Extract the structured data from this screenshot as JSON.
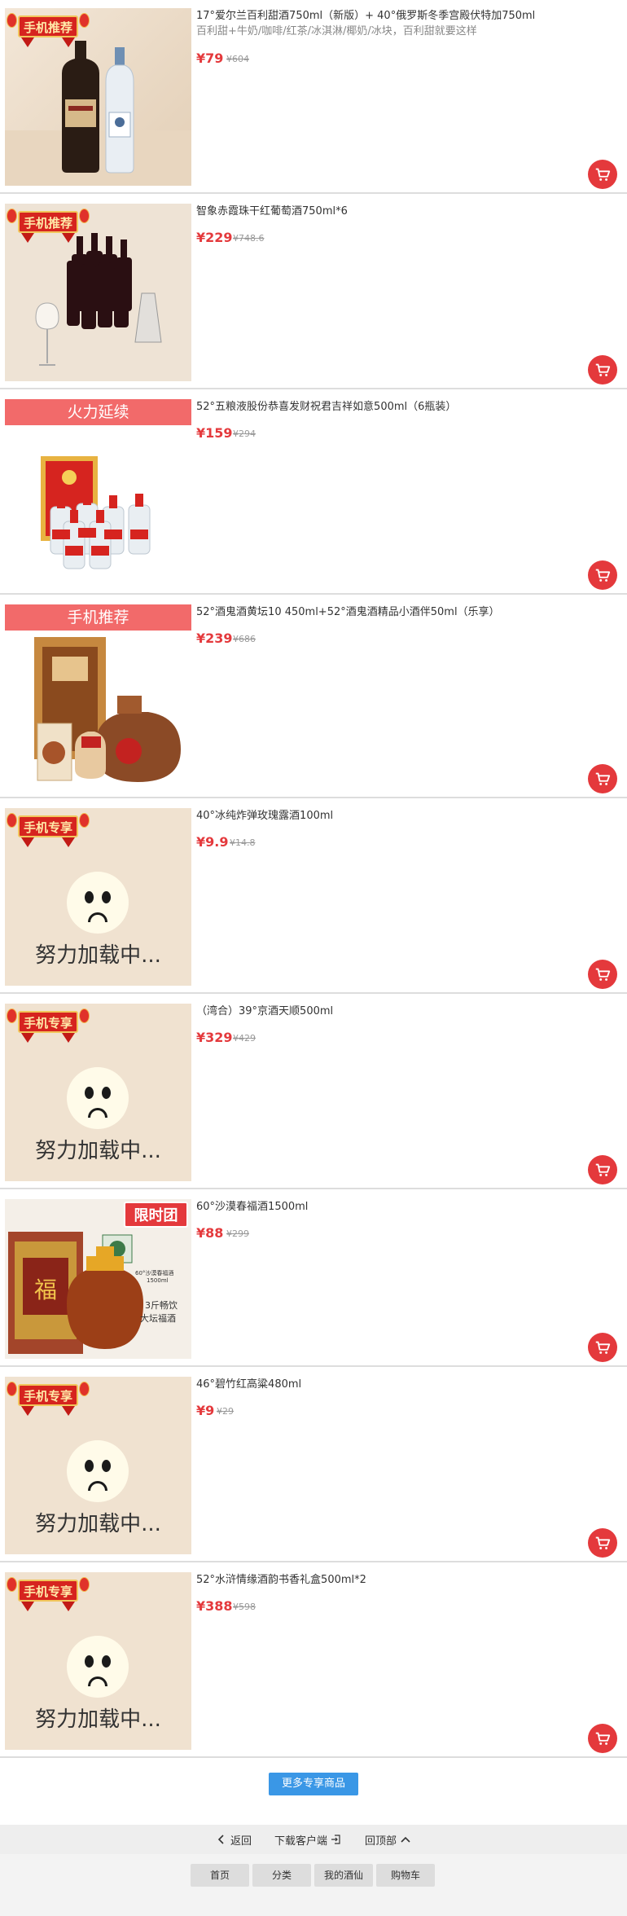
{
  "products": [
    {
      "title": "17°爱尔兰百利甜酒750ml（新版）+ 40°俄罗斯冬季宫殿伏特加750ml",
      "subtitle": "百利甜+牛奶/咖啡/红茶/冰淇淋/椰奶/冰块，百利甜就要这样",
      "price": "¥79",
      "original_price": "¥604",
      "badge": "手机推荐",
      "badge_style": "ribbon",
      "image": "bottles",
      "cart_icon": "cart-icon"
    },
    {
      "title": "智象赤霞珠干红葡萄酒750ml*6",
      "subtitle": "",
      "price": "¥229",
      "original_price": "¥748.6",
      "badge": "手机推荐",
      "badge_style": "ribbon",
      "image": "wine-set"
    },
    {
      "title": "52°五粮液股份恭喜发财祝君吉祥如意500ml（6瓶装）",
      "subtitle": "",
      "price": "¥159",
      "original_price": "¥294",
      "badge": "火力延续",
      "badge_style": "flat",
      "image": "liquor-box"
    },
    {
      "title": "52°酒鬼酒黄坛10 450ml+52°酒鬼酒精品小酒伴50ml（乐享）",
      "subtitle": "",
      "price": "¥239",
      "original_price": "¥686",
      "badge": "手机推荐",
      "badge_style": "flat",
      "image": "jiugui"
    },
    {
      "title": "40°冰纯炸弹玫瑰露酒100ml",
      "subtitle": "",
      "price": "¥9.9",
      "original_price": "¥14.8",
      "badge": "手机专享",
      "badge_style": "ribbon",
      "image": "loading",
      "loading_text": "努力加载中..."
    },
    {
      "title": "（湾合）39°京酒天顺500ml",
      "subtitle": "",
      "price": "¥329",
      "original_price": "¥429",
      "badge": "手机专享",
      "badge_style": "ribbon",
      "image": "loading",
      "loading_text": "努力加载中..."
    },
    {
      "title": "60°沙漠春福酒1500ml",
      "subtitle": "",
      "price": "¥88",
      "original_price": "¥299",
      "badge": "限时团",
      "badge_style": "tag",
      "image": "fu-jar",
      "image_texts": [
        "福",
        "60°沙漠春福酒",
        "1500ml",
        "3斤畅饮",
        "大坛福酒"
      ]
    },
    {
      "title": "46°碧竹红高粱480ml",
      "subtitle": "",
      "price": "¥9",
      "original_price": "¥29",
      "badge": "手机专享",
      "badge_style": "ribbon",
      "image": "loading",
      "loading_text": "努力加载中..."
    },
    {
      "title": "52°水浒情缘酒韵书香礼盒500ml*2",
      "subtitle": "",
      "price": "¥388",
      "original_price": "¥598",
      "badge": "手机专享",
      "badge_style": "ribbon",
      "image": "loading",
      "loading_text": "努力加载中..."
    }
  ],
  "more_button": "更多专享商品",
  "footer_nav": {
    "back": "返回",
    "download": "下载客户端",
    "top": "回顶部"
  },
  "tabs": [
    "首页",
    "分类",
    "我的酒仙",
    "购物车"
  ],
  "colors": {
    "price_red": "#e4393c",
    "more_blue": "#3a97e6",
    "divider": "#dddddd"
  }
}
